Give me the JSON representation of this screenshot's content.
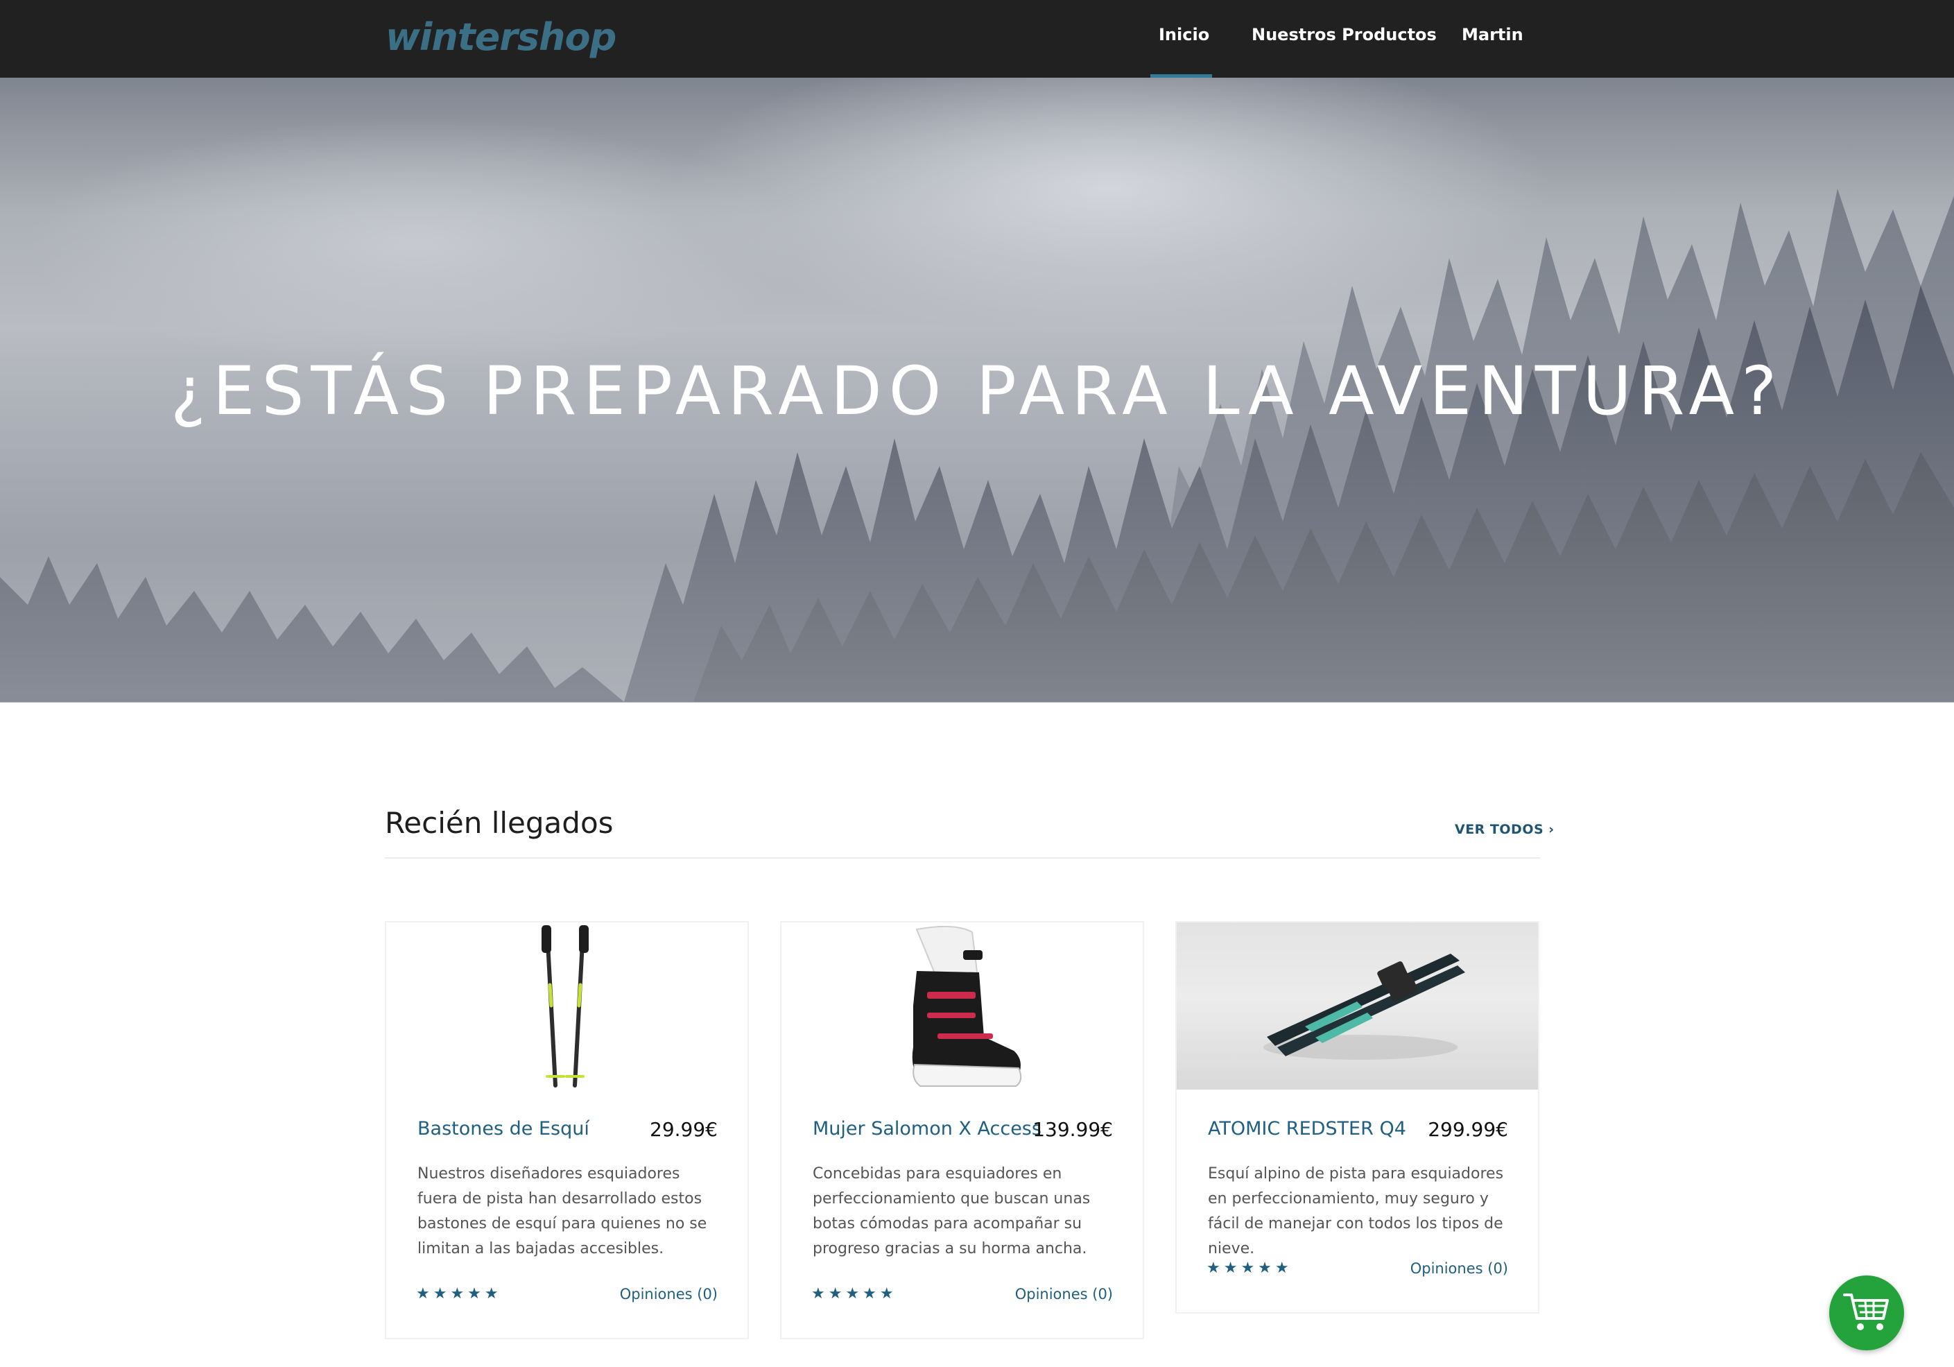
{
  "header": {
    "logo": "wintershop",
    "nav": [
      {
        "label": "Inicio",
        "active": true
      },
      {
        "label": "Nuestros Productos",
        "active": false
      },
      {
        "label": "Martin",
        "active": false
      }
    ]
  },
  "hero": {
    "title": "¿ESTÁS PREPARADO PARA LA AVENTURA?",
    "slides": 3,
    "active_slide": 1
  },
  "section": {
    "title": "Recién llegados",
    "see_all": "VER TODOS ›"
  },
  "products": [
    {
      "name": "Bastones de Esquí",
      "price": "29.99€",
      "description": "Nuestros diseñadores esquiadores fuera de pista han desarrollado estos bastones de esquí para quienes no se limitan a las bajadas accesibles.",
      "rating": 5,
      "stars": "★★★★★",
      "reviews": "Opiniones (0)"
    },
    {
      "name": "Mujer Salomon X Access",
      "price": "139.99€",
      "description": "Concebidas para esquiadores en perfeccionamiento que buscan unas botas cómodas para acompañar su progreso gracias a su horma ancha.",
      "rating": 5,
      "stars": "★★★★★",
      "reviews": "Opiniones (0)"
    },
    {
      "name": "ATOMIC REDSTER Q4",
      "price": "299.99€",
      "description": "Esquí alpino de pista para esquiadores en perfeccionamiento, muy seguro y fácil de manejar con todos los tipos de nieve.",
      "rating": 5,
      "stars": "★★★★★",
      "reviews": "Opiniones (0)"
    }
  ],
  "cart": {
    "icon": "shopping-cart-icon"
  },
  "colors": {
    "header_bg": "#212121",
    "accent": "#2f7c99",
    "link": "#1f5f82",
    "cart_button": "#24a33c"
  }
}
